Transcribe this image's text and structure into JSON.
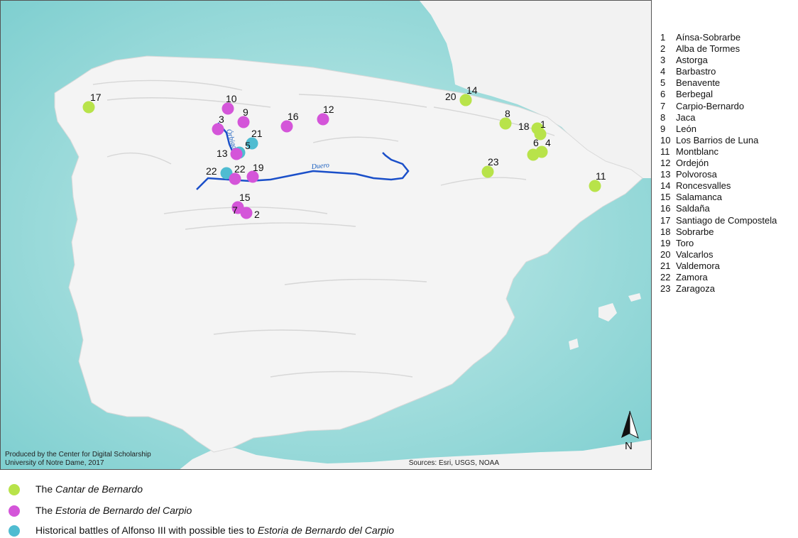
{
  "colors": {
    "cantar": "#b8e34a",
    "estoria": "#d455d9",
    "battles": "#4fbcd1",
    "river": "#1a4fc9",
    "sea": "#a9dcdc",
    "land": "#f4f4f4"
  },
  "credit": {
    "line1": "Produced by the Center for Digital Scholarship",
    "line2": "University of Notre Dame, 2017"
  },
  "sources": "Sources: Esri, USGS, NOAA",
  "north_label": "N",
  "rivers": {
    "duero": "Duero",
    "orbigo": "Órbigo"
  },
  "places": [
    {
      "n": "1",
      "name": "Aínsa-Sobrarbe"
    },
    {
      "n": "2",
      "name": "Alba de Tormes"
    },
    {
      "n": "3",
      "name": "Astorga"
    },
    {
      "n": "4",
      "name": "Barbastro"
    },
    {
      "n": "5",
      "name": "Benavente"
    },
    {
      "n": "6",
      "name": "Berbegal"
    },
    {
      "n": "7",
      "name": "Carpio-Bernardo"
    },
    {
      "n": "8",
      "name": "Jaca"
    },
    {
      "n": "9",
      "name": "León"
    },
    {
      "n": "10",
      "name": "Los Barrios de Luna"
    },
    {
      "n": "11",
      "name": "Montblanc"
    },
    {
      "n": "12",
      "name": "Ordejón"
    },
    {
      "n": "13",
      "name": "Polvorosa"
    },
    {
      "n": "14",
      "name": "Roncesvalles"
    },
    {
      "n": "15",
      "name": "Salamanca"
    },
    {
      "n": "16",
      "name": "Saldaña"
    },
    {
      "n": "17",
      "name": "Santiago de Compostela"
    },
    {
      "n": "18",
      "name": "Sobrarbe"
    },
    {
      "n": "19",
      "name": "Toro"
    },
    {
      "n": "20",
      "name": "Valcarlos"
    },
    {
      "n": "21",
      "name": "Valdemora"
    },
    {
      "n": "22",
      "name": "Zamora"
    },
    {
      "n": "23",
      "name": "Zaragoza"
    }
  ],
  "markers": [
    {
      "label": "17",
      "group": "cantar"
    },
    {
      "label": "10",
      "group": "estoria"
    },
    {
      "label": "9",
      "group": "estoria"
    },
    {
      "label": "3",
      "group": "estoria"
    },
    {
      "label": "16",
      "group": "estoria"
    },
    {
      "label": "12",
      "group": "estoria"
    },
    {
      "label": "21",
      "group": "battles"
    },
    {
      "label": "5",
      "group": "battles"
    },
    {
      "label": "13",
      "group": "estoria"
    },
    {
      "label": "22",
      "group": "battles"
    },
    {
      "label": "22",
      "group": "estoria"
    },
    {
      "label": "19",
      "group": "estoria"
    },
    {
      "label": "15",
      "group": "estoria"
    },
    {
      "label": "7",
      "group": "estoria"
    },
    {
      "label": "2",
      "group": "estoria"
    },
    {
      "label": "20",
      "group": "cantar"
    },
    {
      "label": "14",
      "group": "cantar"
    },
    {
      "label": "8",
      "group": "cantar"
    },
    {
      "label": "18",
      "group": "cantar"
    },
    {
      "label": "1",
      "group": "cantar"
    },
    {
      "label": "6",
      "group": "cantar"
    },
    {
      "label": "4",
      "group": "cantar"
    },
    {
      "label": "23",
      "group": "cantar"
    },
    {
      "label": "11",
      "group": "cantar"
    }
  ],
  "legend": [
    {
      "group": "cantar",
      "prefix": "The ",
      "italic": "Cantar de Bernardo",
      "suffix": ""
    },
    {
      "group": "estoria",
      "prefix": "The ",
      "italic": "Estoria de Bernardo del Carpio",
      "suffix": ""
    },
    {
      "group": "battles",
      "prefix": "Historical battles of Alfonso III with possible ties to ",
      "italic": "Estoria de Bernardo del Carpio",
      "suffix": ""
    }
  ]
}
